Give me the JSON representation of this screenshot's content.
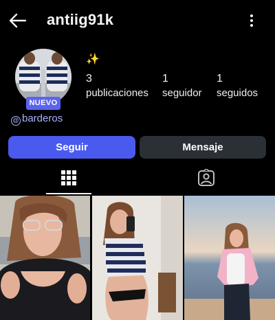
{
  "header": {
    "username": "antiig91k",
    "back_icon": "arrow-left-icon",
    "more_icon": "more-vertical-icon"
  },
  "profile": {
    "new_badge": "NUEVO",
    "threads_handle": "barderos",
    "sparkle": "✨"
  },
  "stats": [
    {
      "value": "3",
      "label": "publicaciones"
    },
    {
      "value": "1",
      "label": "seguidor"
    },
    {
      "value": "1",
      "label": "seguidos"
    }
  ],
  "actions": {
    "follow_label": "Seguir",
    "message_label": "Mensaje"
  },
  "tabs": [
    {
      "icon": "grid-icon",
      "active": true
    },
    {
      "icon": "tagged-person-icon",
      "active": false
    }
  ],
  "colors": {
    "background": "#000000",
    "follow_button": "#4a5aef",
    "message_button": "#2b2f36",
    "badge": "#5b63ef",
    "link": "#a9b3ff"
  }
}
